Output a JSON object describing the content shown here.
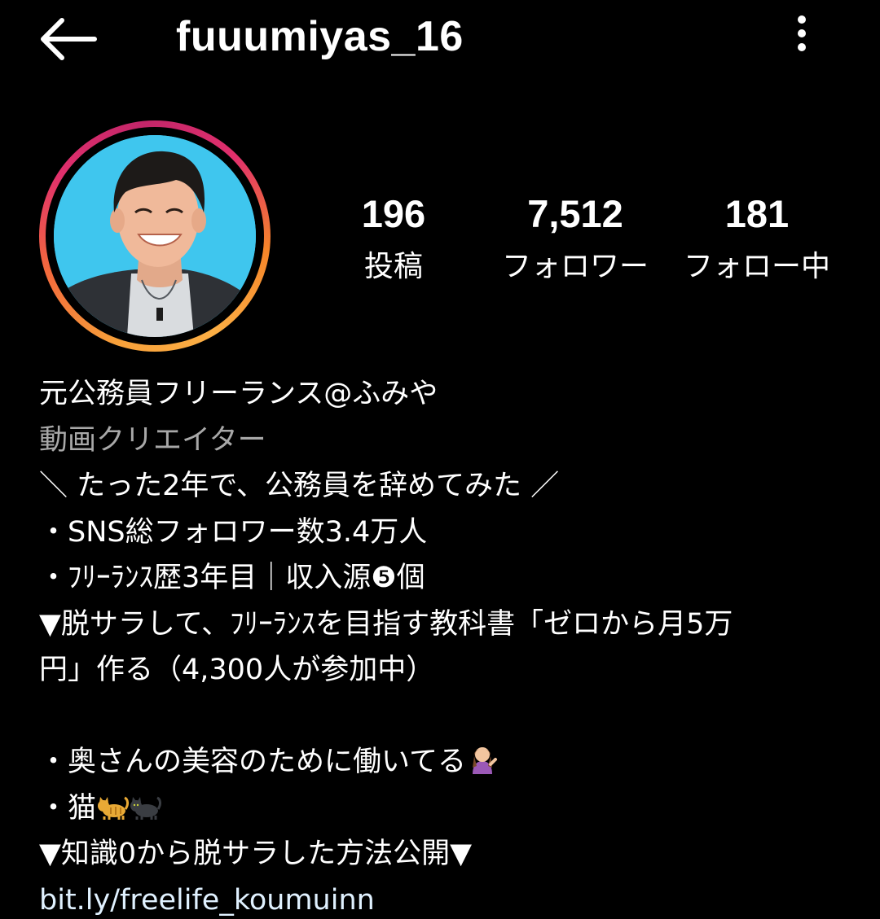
{
  "header": {
    "username": "fuuumiyas_16"
  },
  "stats": {
    "posts": {
      "value": "196",
      "label": "投稿"
    },
    "followers": {
      "value": "7,512",
      "label": "フォロワー"
    },
    "following": {
      "value": "181",
      "label": "フォロー中"
    }
  },
  "bio": {
    "name": "元公務員フリーランス@ふみや",
    "category": "動画クリエイター",
    "lines": [
      "＼ たった2年で、公務員を辞めてみた ／",
      "・SNS総フォロワー数3.4万人",
      "・ﾌﾘｰﾗﾝｽ歴3年目｜収入源❺個",
      "▼脱サラして、ﾌﾘｰﾗﾝｽを目指す教科書「ゼロから月5万",
      "円」作る（4,300人が参加中）",
      "",
      "・奥さんの美容のために働いてる",
      "・猫",
      "▼知識0から脱サラした方法公開▼"
    ],
    "link": "bit.ly/freelife_koumuinn"
  },
  "icons": {
    "back": "back-arrow-icon",
    "more": "more-vertical-icon",
    "woman_emoji": "woman-tipping-hand-icon",
    "cat_emoji_1": "cat-icon",
    "cat_emoji_2": "black-cat-icon"
  },
  "colors": {
    "background": "#000000",
    "text": "#ffffff",
    "secondary_text": "#a8a8a8",
    "link": "#e0f1ff",
    "avatar_background": "#3fc6ee"
  }
}
